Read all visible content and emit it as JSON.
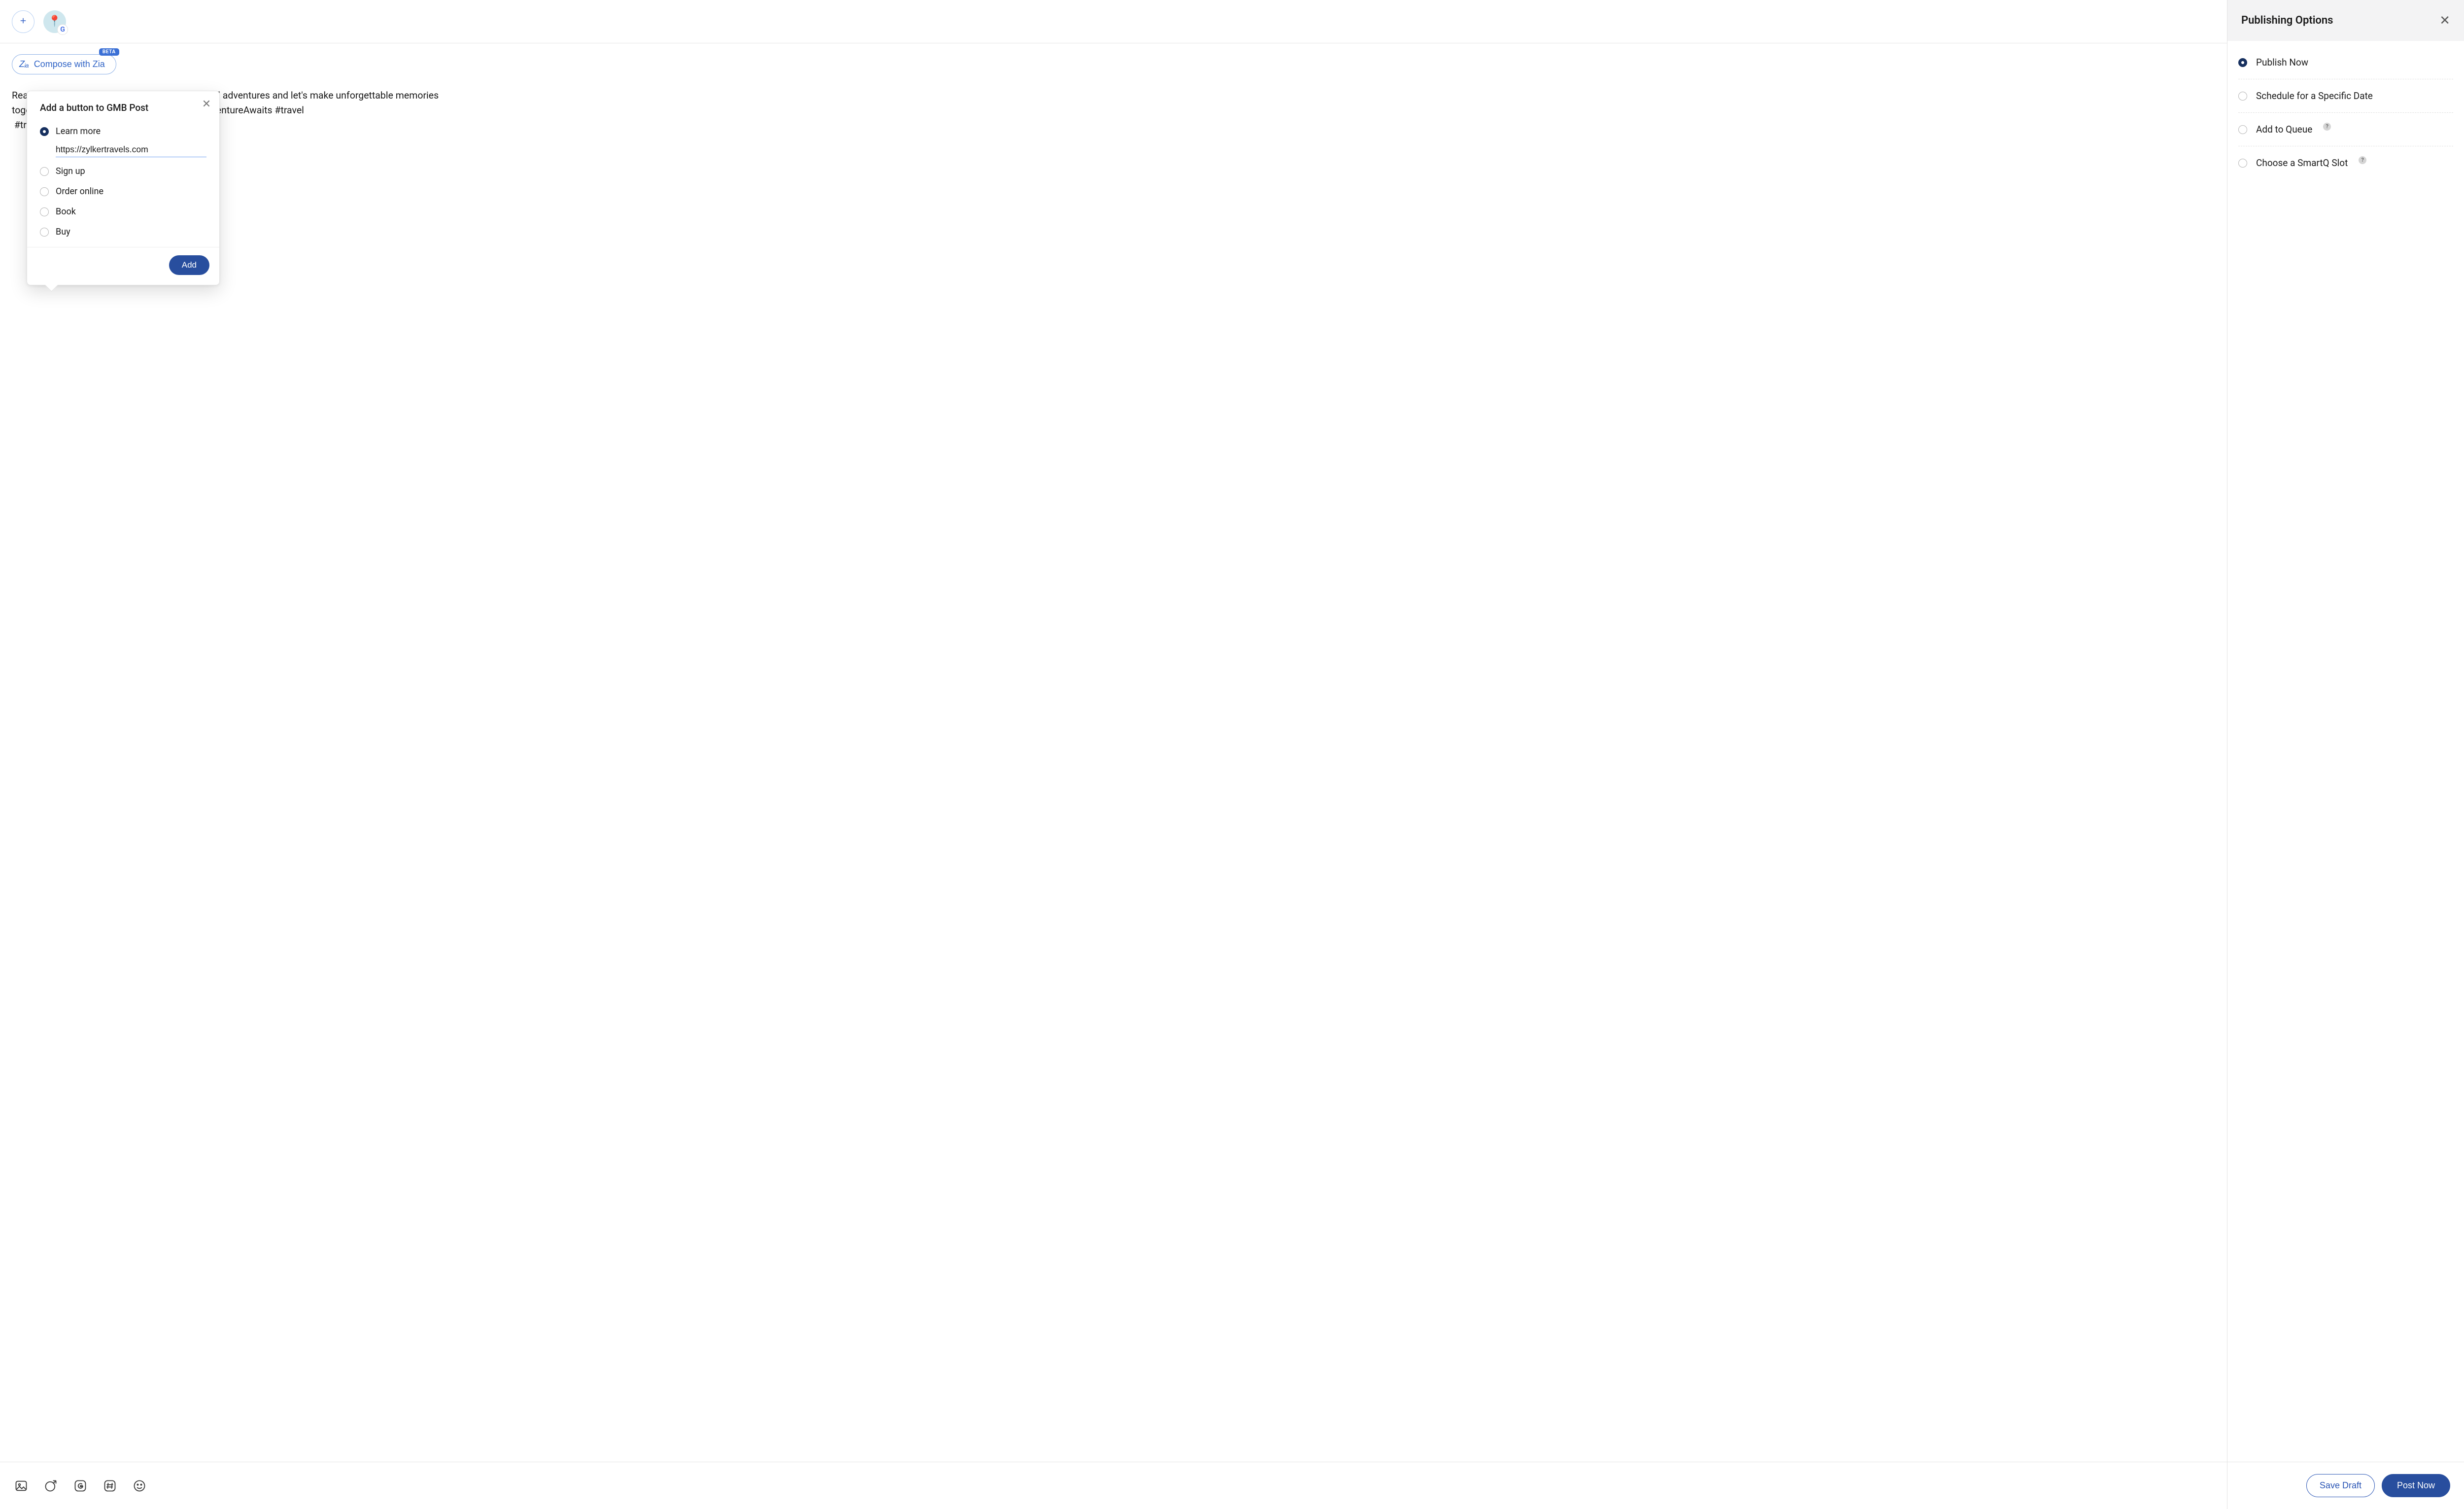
{
  "header": {
    "channel_emoji": "📍",
    "channel_badge_letter": "G"
  },
  "zia": {
    "label": "Compose with Zia",
    "beta_label": "BETA",
    "glyph": "Zᵢₐ"
  },
  "post_text": "Ready to explore the world? Join me on my travel adventures and let's make unforgettable memories together! 🏝️🌴 #TravelGoals #Wanderlust #AdventureAwaits #travel\n #travel #travelgram #photoshoot",
  "gmb_popover": {
    "title": "Add a button to GMB Post",
    "url_value": "https://zylkertravels.com",
    "options": [
      {
        "label": "Learn more",
        "selected": true
      },
      {
        "label": "Sign up",
        "selected": false
      },
      {
        "label": "Order online",
        "selected": false
      },
      {
        "label": "Book",
        "selected": false
      },
      {
        "label": "Buy",
        "selected": false
      }
    ],
    "add_button": "Add"
  },
  "sidebar": {
    "title": "Publishing Options",
    "options": [
      {
        "label": "Publish Now",
        "selected": true,
        "help": false
      },
      {
        "label": "Schedule for a Specific Date",
        "selected": false,
        "help": false
      },
      {
        "label": "Add to Queue",
        "selected": false,
        "help": true
      },
      {
        "label": "Choose a SmartQ Slot",
        "selected": false,
        "help": true
      }
    ]
  },
  "footer": {
    "save_draft": "Save Draft",
    "post_now": "Post Now"
  },
  "help_glyph": "?"
}
